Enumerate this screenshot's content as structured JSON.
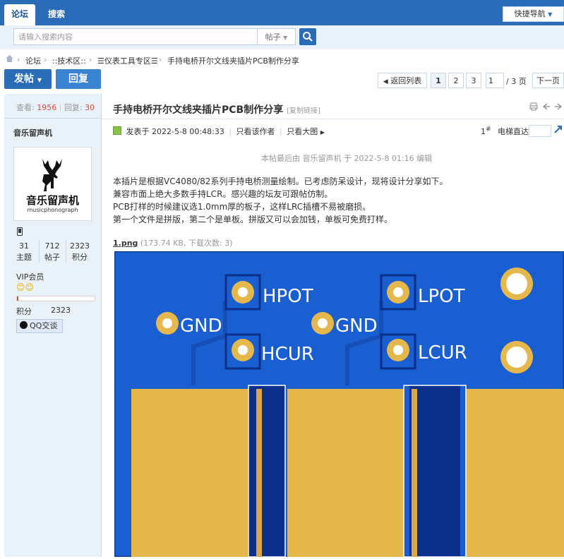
{
  "topnav": {
    "tab_forum": "论坛",
    "tab_search": "搜索",
    "quicknav_label": "快捷导航"
  },
  "search": {
    "placeholder": "请输入搜索内容",
    "scope": "帖子"
  },
  "breadcrumb": [
    "论坛",
    "::技术区::",
    "仪表工具专区",
    "手持电桥开尔文线夹插片PCB制作分享"
  ],
  "actions": {
    "post_label": "发帖",
    "reply_label": "回复"
  },
  "pager": {
    "back_label": "返回列表",
    "pages": [
      "1",
      "2",
      "3"
    ],
    "current_input": "1",
    "total_label": "/ 3 页",
    "next_label": "下一页"
  },
  "stats": {
    "views_label": "查看:",
    "views": "1956",
    "replies_label": "回复:",
    "replies": "30"
  },
  "author": {
    "name": "音乐留声机",
    "logo_text": "音乐留声机",
    "logo_sub": "musicphonograph",
    "counts": [
      {
        "value": "31",
        "label": "主题"
      },
      {
        "value": "712",
        "label": "帖子"
      },
      {
        "value": "2323",
        "label": "积分"
      }
    ],
    "group": "VIP会员",
    "score_label": "积分",
    "score": "2323",
    "qq_label": "QQ交谈"
  },
  "post": {
    "title": "手持电桥开尔文线夹插片PCB制作分享",
    "copy_link": "[复制链接]",
    "posted": "发表于 2022-5-8 00:48:33",
    "only_author": "只看该作者",
    "only_big": "只看大图",
    "floor": "1",
    "floor_mark": "#",
    "jump_label": "电梯直达",
    "edit_note": "本帖最后由 音乐留声机 于 2022-5-8 01:16 编辑",
    "lines": [
      "本插片是根据VC4080/82系列手持电桥测量绘制。已考虑防呆设计，现将设计分享如下。",
      "兼容市面上绝大多数手持LCR。感兴趣的坛友可跟帖仿制。",
      "PCB打样的时候建议选1.0mm厚的板子，这样LRC插槽不易被磨损。",
      "第一个文件是拼版，第二个是单板。拼版又可以会加钱，单板可免费打样。"
    ],
    "attachment_name": "1.png",
    "attachment_info": "(173.74 KB, 下载次数: 3)"
  },
  "pcb_labels": {
    "hpot": "HPOT",
    "lpot": "LPOT",
    "gnd": "GND",
    "hcur": "HCUR",
    "lcur": "LCUR"
  },
  "colors": {
    "nav_blue": "#2b6cb8",
    "pcb_blue": "#1a5fd1",
    "pcb_gold": "#e6b84c",
    "pcb_dark": "#0b2f8a",
    "stat_red": "#e0483c"
  }
}
